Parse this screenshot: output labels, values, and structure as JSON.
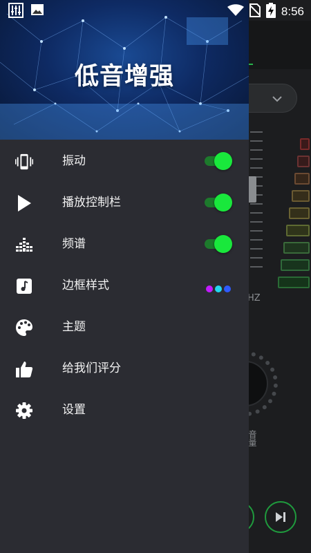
{
  "status_bar": {
    "time": "8:56",
    "icons": [
      "equalizer-app-icon",
      "image-icon",
      "wifi-icon",
      "no-sim-icon",
      "battery-charging-icon"
    ]
  },
  "drawer": {
    "title": "低音增强",
    "items": [
      {
        "label": "振动",
        "icon": "vibration-icon",
        "control": "toggle",
        "on": true
      },
      {
        "label": "播放控制栏",
        "icon": "play-icon",
        "control": "toggle",
        "on": true
      },
      {
        "label": "频谱",
        "icon": "spectrum-icon",
        "control": "toggle",
        "on": true
      },
      {
        "label": "边框样式",
        "icon": "music-note-icon",
        "control": "color-dots",
        "colors": [
          "#c21bff",
          "#23d7f0",
          "#2f5bff"
        ]
      },
      {
        "label": "主题",
        "icon": "palette-icon",
        "control": "none"
      },
      {
        "label": "给我们评分",
        "icon": "thumbs-up-icon",
        "control": "none"
      },
      {
        "label": "设置",
        "icon": "gear-icon",
        "control": "none"
      }
    ]
  },
  "background_app": {
    "hz_label": "HZ",
    "volume_label": "音量"
  },
  "colors": {
    "drawer_bg": "#2b2c32",
    "toggle_on": "#19e83c",
    "accent_green": "#1f9a3d"
  }
}
